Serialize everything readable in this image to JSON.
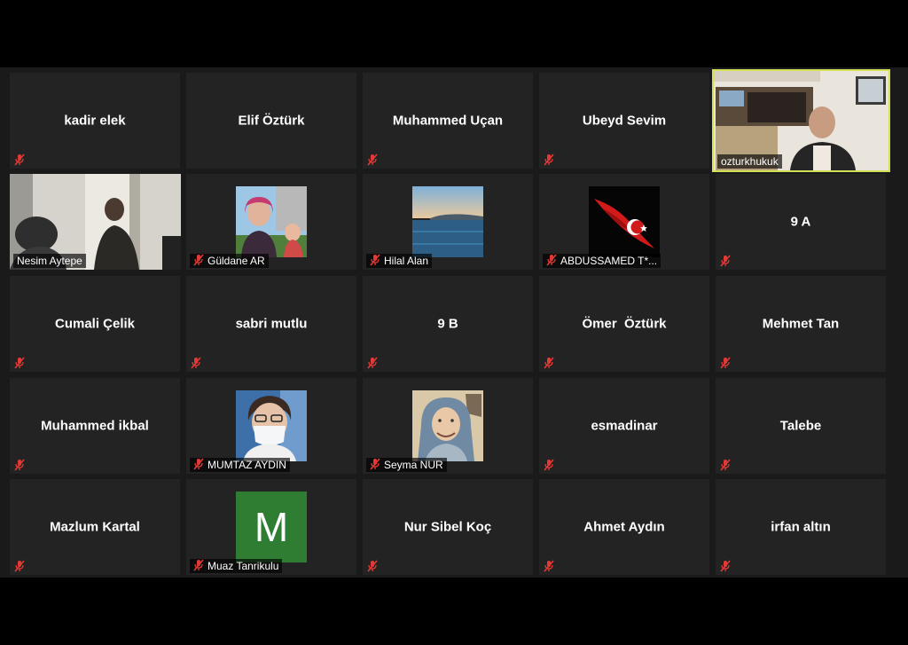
{
  "participants": [
    {
      "name": "kadir elek"
    },
    {
      "name": "Elif Öztürk"
    },
    {
      "name": "Muhammed Uçan"
    },
    {
      "name": "Ubeyd Sevim"
    },
    {
      "name": "ozturkhukuk",
      "active": true
    },
    {
      "name": "Nesim Aytepe"
    },
    {
      "name": "Güldane AR"
    },
    {
      "name": "Hilal Alan"
    },
    {
      "name": "ABDUSSAMED T*..."
    },
    {
      "name": "9 A"
    },
    {
      "name": "Cumali Çelik"
    },
    {
      "name": "sabri mutlu"
    },
    {
      "name": "9 B"
    },
    {
      "name": "Ömer  Öztürk"
    },
    {
      "name": "Mehmet Tan"
    },
    {
      "name": "Muhammed ikbal"
    },
    {
      "name": "MUMTAZ AYDIN"
    },
    {
      "name": "Seyma NUR"
    },
    {
      "name": "esmadinar"
    },
    {
      "name": "Talebe"
    },
    {
      "name": "Mazlum Kartal"
    },
    {
      "name": "Muaz Tanrikulu",
      "avatar_letter": "M"
    },
    {
      "name": "Nur Sibel Koç"
    },
    {
      "name": "Ahmet Aydın"
    },
    {
      "name": "irfan altın"
    }
  ],
  "colors": {
    "active_border": "#d4e157",
    "muted_icon": "#e53935",
    "tile_bg": "#232323",
    "letter_avatar_bg": "#2e7d32"
  }
}
